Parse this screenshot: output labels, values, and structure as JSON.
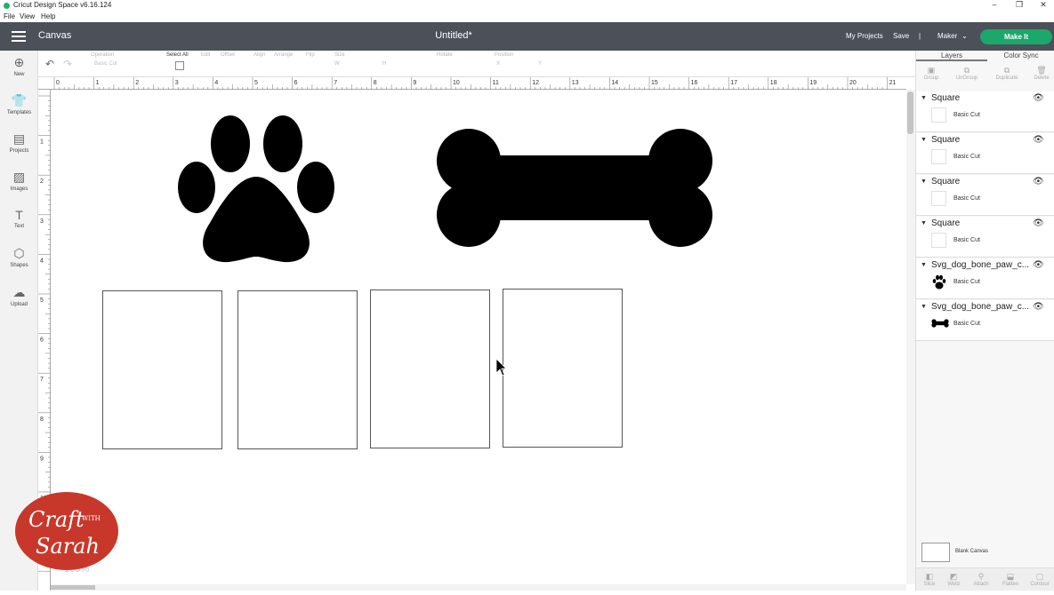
{
  "window": {
    "title": "Cricut Design Space  v6.16.124",
    "controls": [
      "–",
      "❐",
      "✕"
    ]
  },
  "menu": {
    "items": [
      "File",
      "View",
      "Help"
    ]
  },
  "header": {
    "section": "Canvas",
    "doc_title": "Untitled*",
    "my_projects": "My Projects",
    "save": "Save",
    "separator": "|",
    "machine": "Maker",
    "make_it": "Make It",
    "accent_color": "#1ca86b"
  },
  "toolbar": {
    "undo_icon": "undo-icon",
    "redo_icon": "redo-icon",
    "operation_label": "Operation",
    "operation_value": "Basic Cut",
    "select_all": "Select All",
    "edit": "Edit",
    "offset": "Offset",
    "align": "Align",
    "arrange": "Arrange",
    "flip": "Flip",
    "size": "Size",
    "w": "W",
    "h": "H",
    "rotate": "Rotate",
    "position": "Position",
    "x": "X",
    "y": "Y"
  },
  "leftnav": [
    {
      "label": "New",
      "icon": "plus-circle-icon"
    },
    {
      "label": "Templates",
      "icon": "shirt-icon"
    },
    {
      "label": "Projects",
      "icon": "projects-icon"
    },
    {
      "label": "Images",
      "icon": "image-icon"
    },
    {
      "label": "Text",
      "icon": "text-icon"
    },
    {
      "label": "Shapes",
      "icon": "shapes-icon"
    },
    {
      "label": "Upload",
      "icon": "upload-icon"
    }
  ],
  "ruler": {
    "top": [
      "0",
      "1",
      "2",
      "3",
      "4",
      "5",
      "6",
      "7",
      "8",
      "9",
      "10",
      "11",
      "12",
      "13",
      "14",
      "15",
      "16",
      "17",
      "18",
      "19",
      "20",
      "21"
    ],
    "left": [
      "1",
      "2",
      "3",
      "4",
      "5",
      "6",
      "7",
      "8",
      "9",
      "10"
    ]
  },
  "panel": {
    "tabs": [
      "Layers",
      "Color Sync"
    ],
    "actions": [
      "Group",
      "UnGroup",
      "Duplicate",
      "Delete"
    ],
    "layers": [
      {
        "name": "Square",
        "type": "Basic Cut",
        "thumb": "blank"
      },
      {
        "name": "Square",
        "type": "Basic Cut",
        "thumb": "blank"
      },
      {
        "name": "Square",
        "type": "Basic Cut",
        "thumb": "blank"
      },
      {
        "name": "Square",
        "type": "Basic Cut",
        "thumb": "blank"
      },
      {
        "name": "Svg_dog_bone_paw_c...",
        "type": "Basic Cut",
        "thumb": "paw"
      },
      {
        "name": "Svg_dog_bone_paw_c...",
        "type": "Basic Cut",
        "thumb": "bone"
      }
    ],
    "blank_canvas": "Blank Canvas",
    "bottom_actions": [
      "Slice",
      "Weld",
      "Attach",
      "Flatten",
      "Contour"
    ]
  },
  "canvas": {
    "zoom": "100%"
  },
  "watermark": {
    "line1": "Craft",
    "with": "WITH",
    "line2": "Sarah",
    "color": "#c8382a"
  }
}
